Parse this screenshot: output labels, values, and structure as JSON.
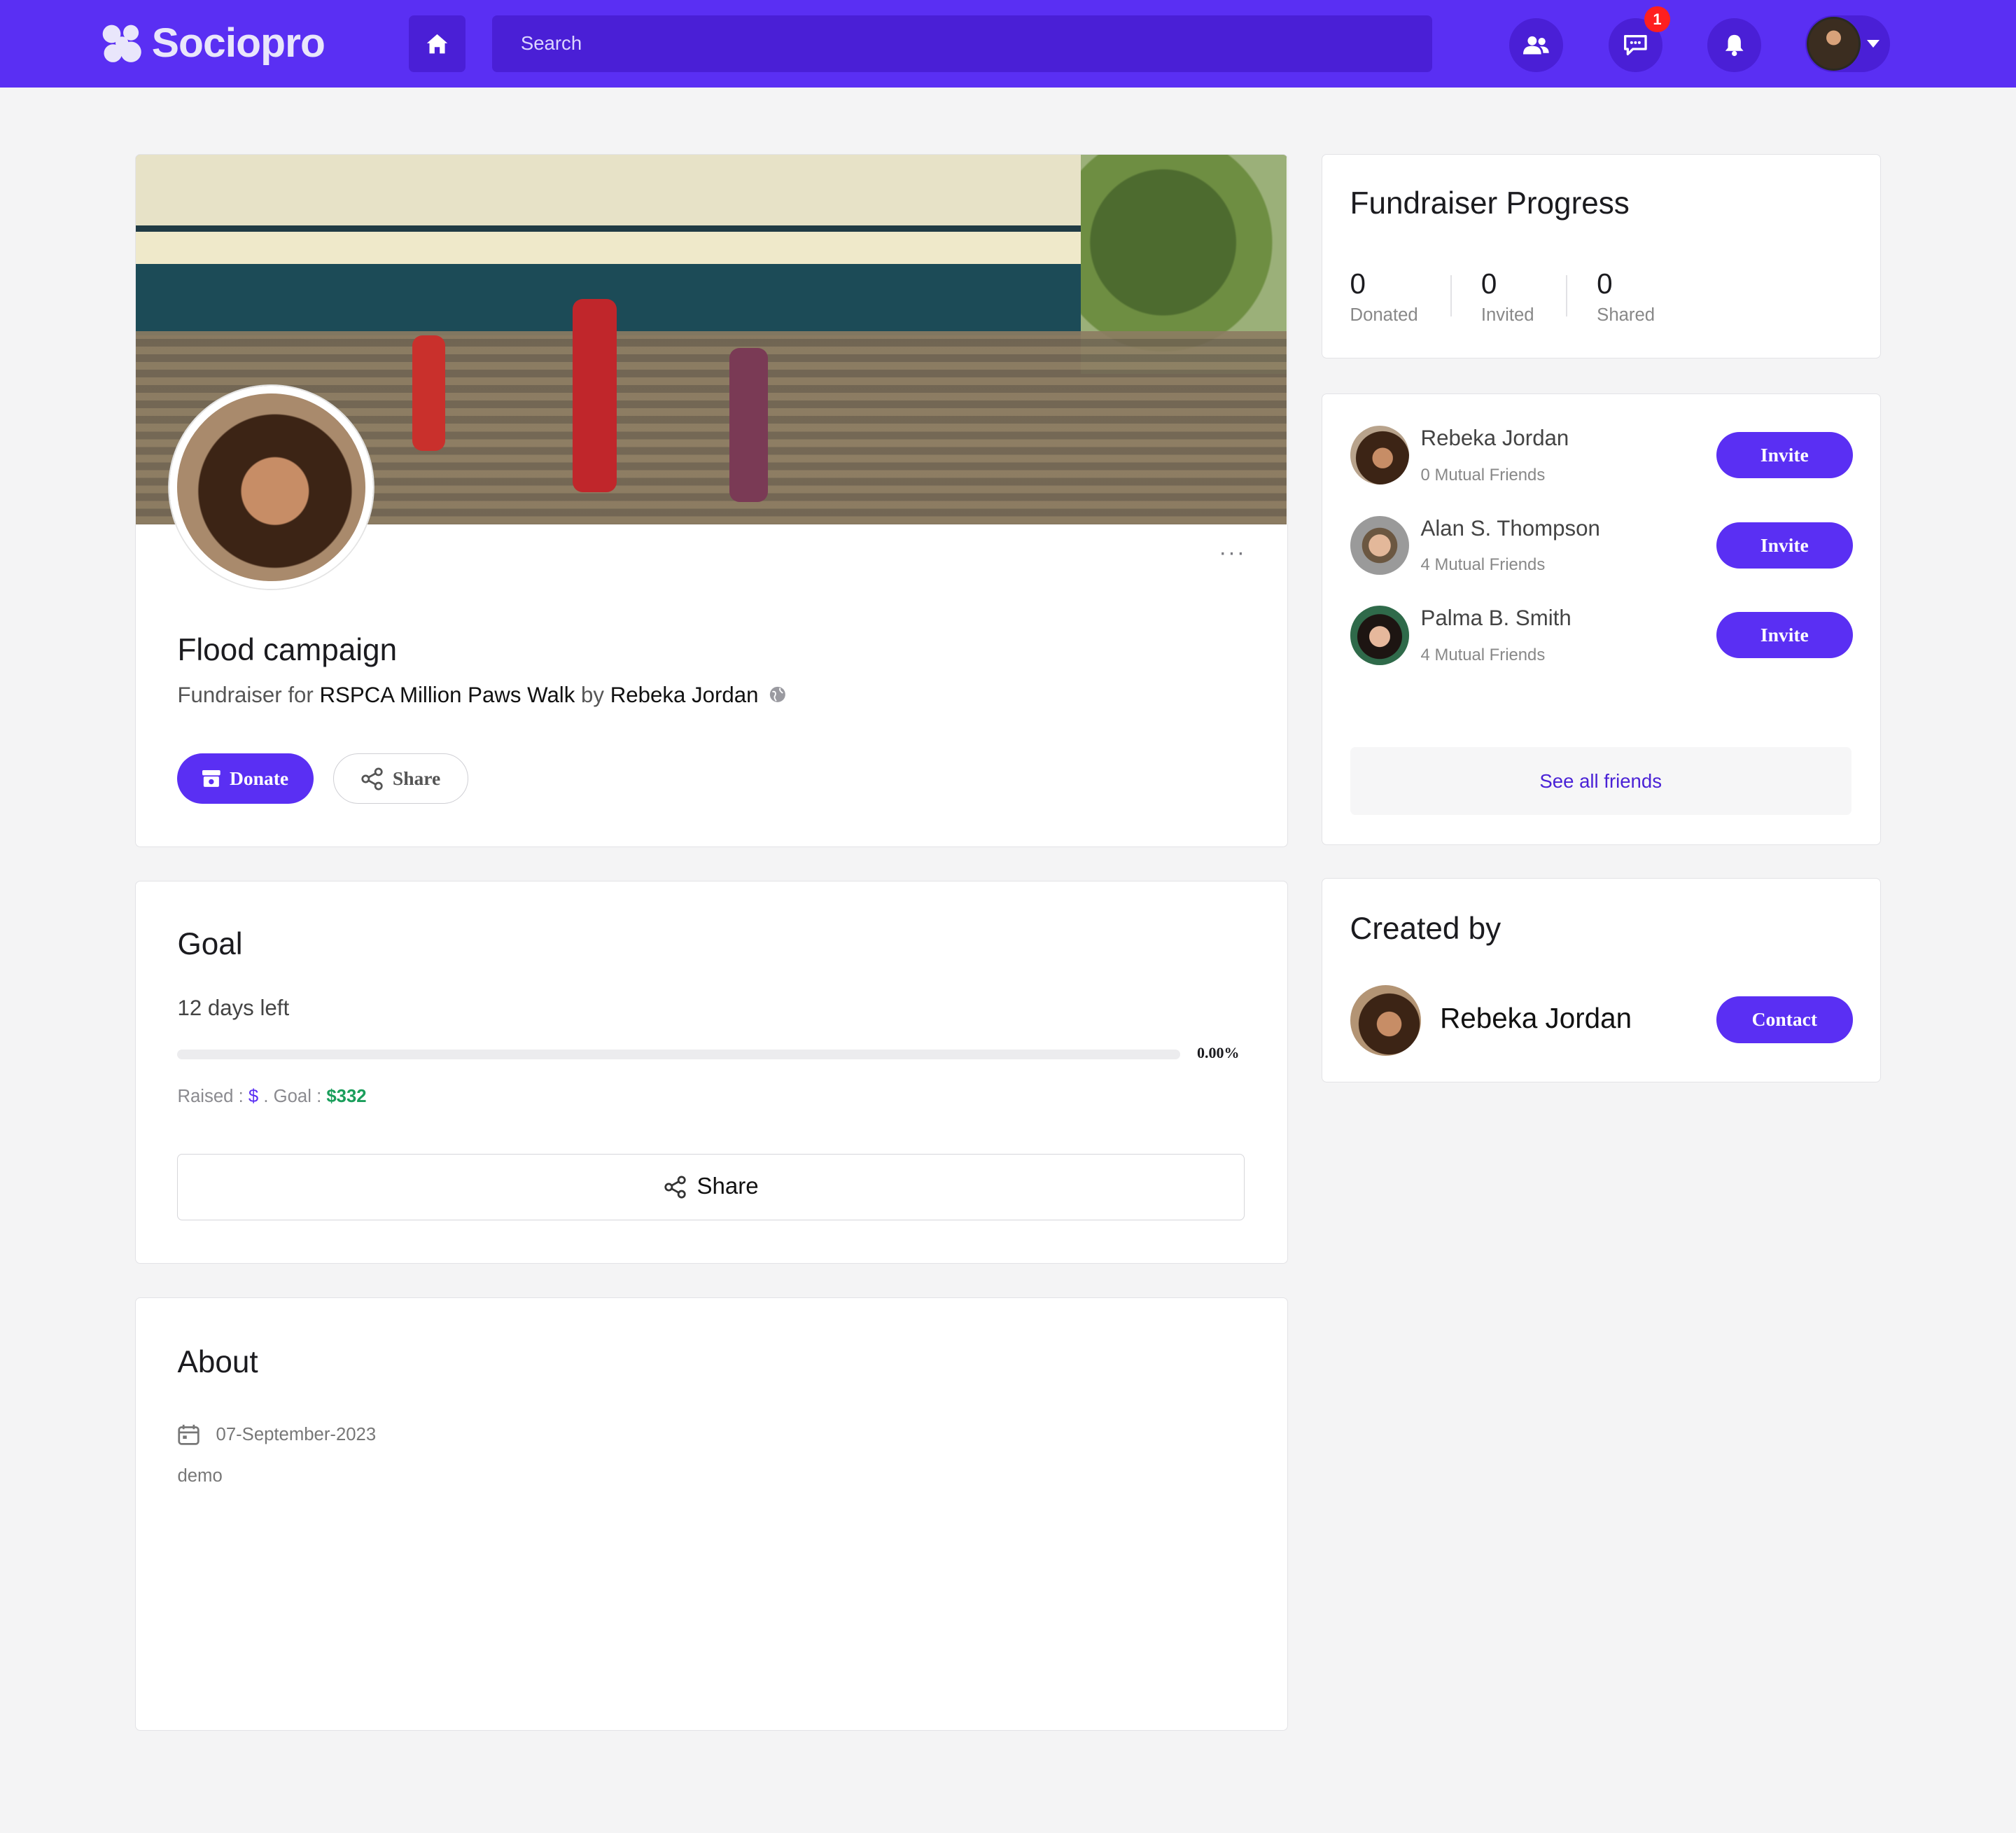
{
  "brand": {
    "name": "Sociopro"
  },
  "search": {
    "placeholder": "Search"
  },
  "nav": {
    "messages_badge": "1"
  },
  "campaign": {
    "title": "Flood campaign",
    "sub_prefix": "Fundraiser for",
    "cause": "RSPCA Million Paws Walk",
    "by_word": "by",
    "organizer": "Rebeka Jordan",
    "donate_label": "Donate",
    "share_label": "Share",
    "more": "···"
  },
  "goal": {
    "heading": "Goal",
    "days_left": "12 days left",
    "progress_fraction": 0,
    "progress_text": "0.00%",
    "raised_label": "Raised :",
    "raised_currency": "$",
    "goal_sep": ". Goal :",
    "goal_amount": "$332",
    "share_label": "Share"
  },
  "about": {
    "heading": "About",
    "date": "07-September-2023",
    "description": "demo"
  },
  "fundraiser_progress": {
    "heading": "Fundraiser Progress",
    "stats": [
      {
        "value": "0",
        "label": "Donated"
      },
      {
        "value": "0",
        "label": "Invited"
      },
      {
        "value": "0",
        "label": "Shared"
      }
    ]
  },
  "friends": {
    "items": [
      {
        "name": "Rebeka Jordan",
        "mutual": "0 Mutual Friends",
        "action": "Invite"
      },
      {
        "name": "Alan S. Thompson",
        "mutual": "4 Mutual Friends",
        "action": "Invite"
      },
      {
        "name": "Palma B. Smith",
        "mutual": "4 Mutual Friends",
        "action": "Invite"
      }
    ],
    "see_all": "See all friends"
  },
  "created_by": {
    "heading": "Created by",
    "name": "Rebeka Jordan",
    "contact_label": "Contact"
  },
  "colors": {
    "accent": "#5a2ff3",
    "nav_dark": "#4a1fd6",
    "success": "#1a9e5b",
    "badge": "#ff1f1f"
  }
}
